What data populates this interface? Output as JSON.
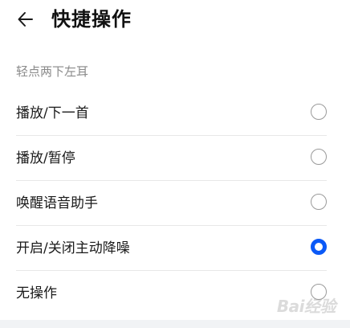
{
  "header": {
    "back_icon": "arrow-left-icon",
    "title": "快捷操作"
  },
  "section": {
    "title": "轻点两下左耳"
  },
  "options": [
    {
      "label": "播放/下一首",
      "selected": false
    },
    {
      "label": "播放/暂停",
      "selected": false
    },
    {
      "label": "唤醒语音助手",
      "selected": false
    },
    {
      "label": "开启/关闭主动降噪",
      "selected": true
    },
    {
      "label": "无操作",
      "selected": false
    }
  ],
  "watermark": {
    "text": "Bai经验"
  },
  "colors": {
    "accent": "#0a59f7",
    "text": "#1a1a1a",
    "secondary": "#8a8a8a",
    "divider": "#e8e8e8"
  }
}
